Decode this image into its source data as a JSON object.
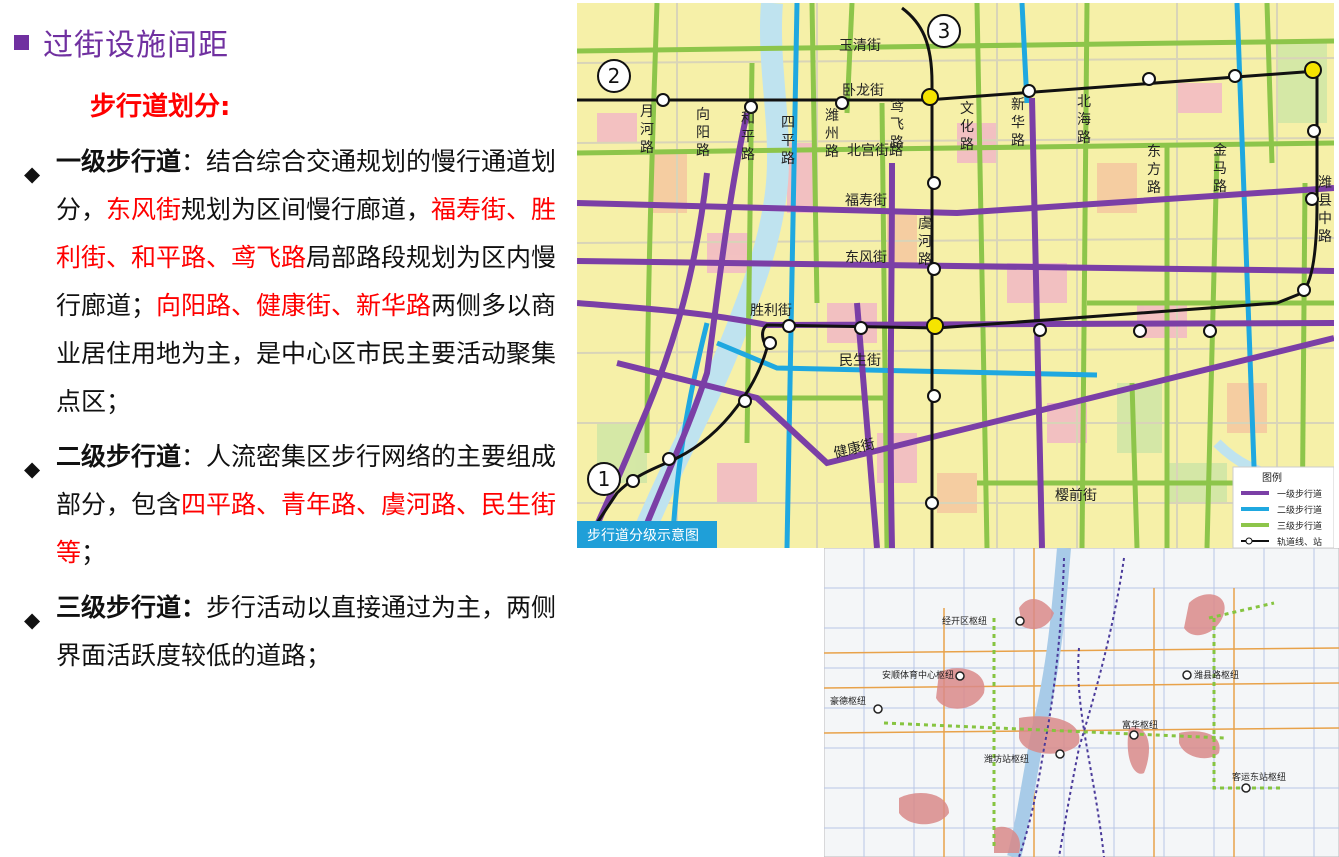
{
  "title": "过街设施间距",
  "subtitle": "步行道划分:",
  "bullets": {
    "b1": {
      "head": "一级步行道",
      "t1": "：结合综合交通规划的慢行通道划分，",
      "r1": "东风街",
      "t2": "规划为区间慢行廊道，",
      "r2": "福寿街、胜利街、和平路、鸢飞路",
      "t3": "局部路段规划为区内慢行廊道；",
      "r3": "向阳路、健康街、新华路",
      "t4": "两侧多以商业居住用地为主，是中心区市民主要活动聚集点区；"
    },
    "b2": {
      "head": "二级步行道",
      "t1": "：人流密集区步行网络的主要组成部分，包含",
      "r1": "四平路、青年路、虞河路、民生街等",
      "t2": "；"
    },
    "b3": {
      "head": "三级步行道：",
      "t1": "步行活动以直接通过为主，两侧界面活跃度较低的道路；"
    }
  },
  "map1": {
    "caption": "步行道分级示意图",
    "line_numbers": [
      "1",
      "2",
      "3"
    ],
    "street_labels": {
      "yuqing": "玉清街",
      "wolong": "卧龙街",
      "fushou": "福寿街",
      "dongfeng": "东风街",
      "shengli": "胜利街",
      "minsheng": "民生街",
      "jiankang": "健康街",
      "yingqian": "樱前街",
      "beigong": "北宫街路"
    },
    "road_labels": [
      {
        "id": "yuehe",
        "chars": [
          "月",
          "河",
          "路"
        ]
      },
      {
        "id": "xiangyang",
        "chars": [
          "向",
          "阳",
          "路"
        ]
      },
      {
        "id": "heping",
        "chars": [
          "和",
          "平",
          "路"
        ]
      },
      {
        "id": "siping",
        "chars": [
          "四",
          "平",
          "路"
        ]
      },
      {
        "id": "weizhou",
        "chars": [
          "潍",
          "州",
          "路"
        ]
      },
      {
        "id": "yuanfei",
        "chars": [
          "鸢",
          "飞",
          "路"
        ]
      },
      {
        "id": "wenhua",
        "chars": [
          "文",
          "化",
          "路"
        ]
      },
      {
        "id": "xinhua",
        "chars": [
          "新",
          "华",
          "路"
        ]
      },
      {
        "id": "beihai",
        "chars": [
          "北",
          "海",
          "路"
        ]
      },
      {
        "id": "dongfang",
        "chars": [
          "东",
          "方",
          "路"
        ]
      },
      {
        "id": "jinma",
        "chars": [
          "金",
          "马",
          "路"
        ]
      },
      {
        "id": "weixianzhong",
        "chars": [
          "潍",
          "县",
          "中",
          "路"
        ]
      },
      {
        "id": "yuhe",
        "chars": [
          "虞",
          "河",
          "路"
        ]
      }
    ],
    "legend": {
      "title": "图例",
      "items": [
        "一级步行道",
        "二级步行道",
        "三级步行道",
        "轨道线、站"
      ]
    },
    "colors": {
      "level1": "#7b3fa6",
      "level2": "#1fa8e0",
      "level3": "#8dc54a",
      "rail": "#111111",
      "station_hub": "#f5e400"
    }
  },
  "map2": {
    "hubs": [
      "经开区枢纽",
      "安顺体育中心枢纽",
      "豪德枢纽",
      "潍县路枢纽",
      "富华枢纽",
      "潍坊站枢纽",
      "客运东站枢纽"
    ]
  }
}
